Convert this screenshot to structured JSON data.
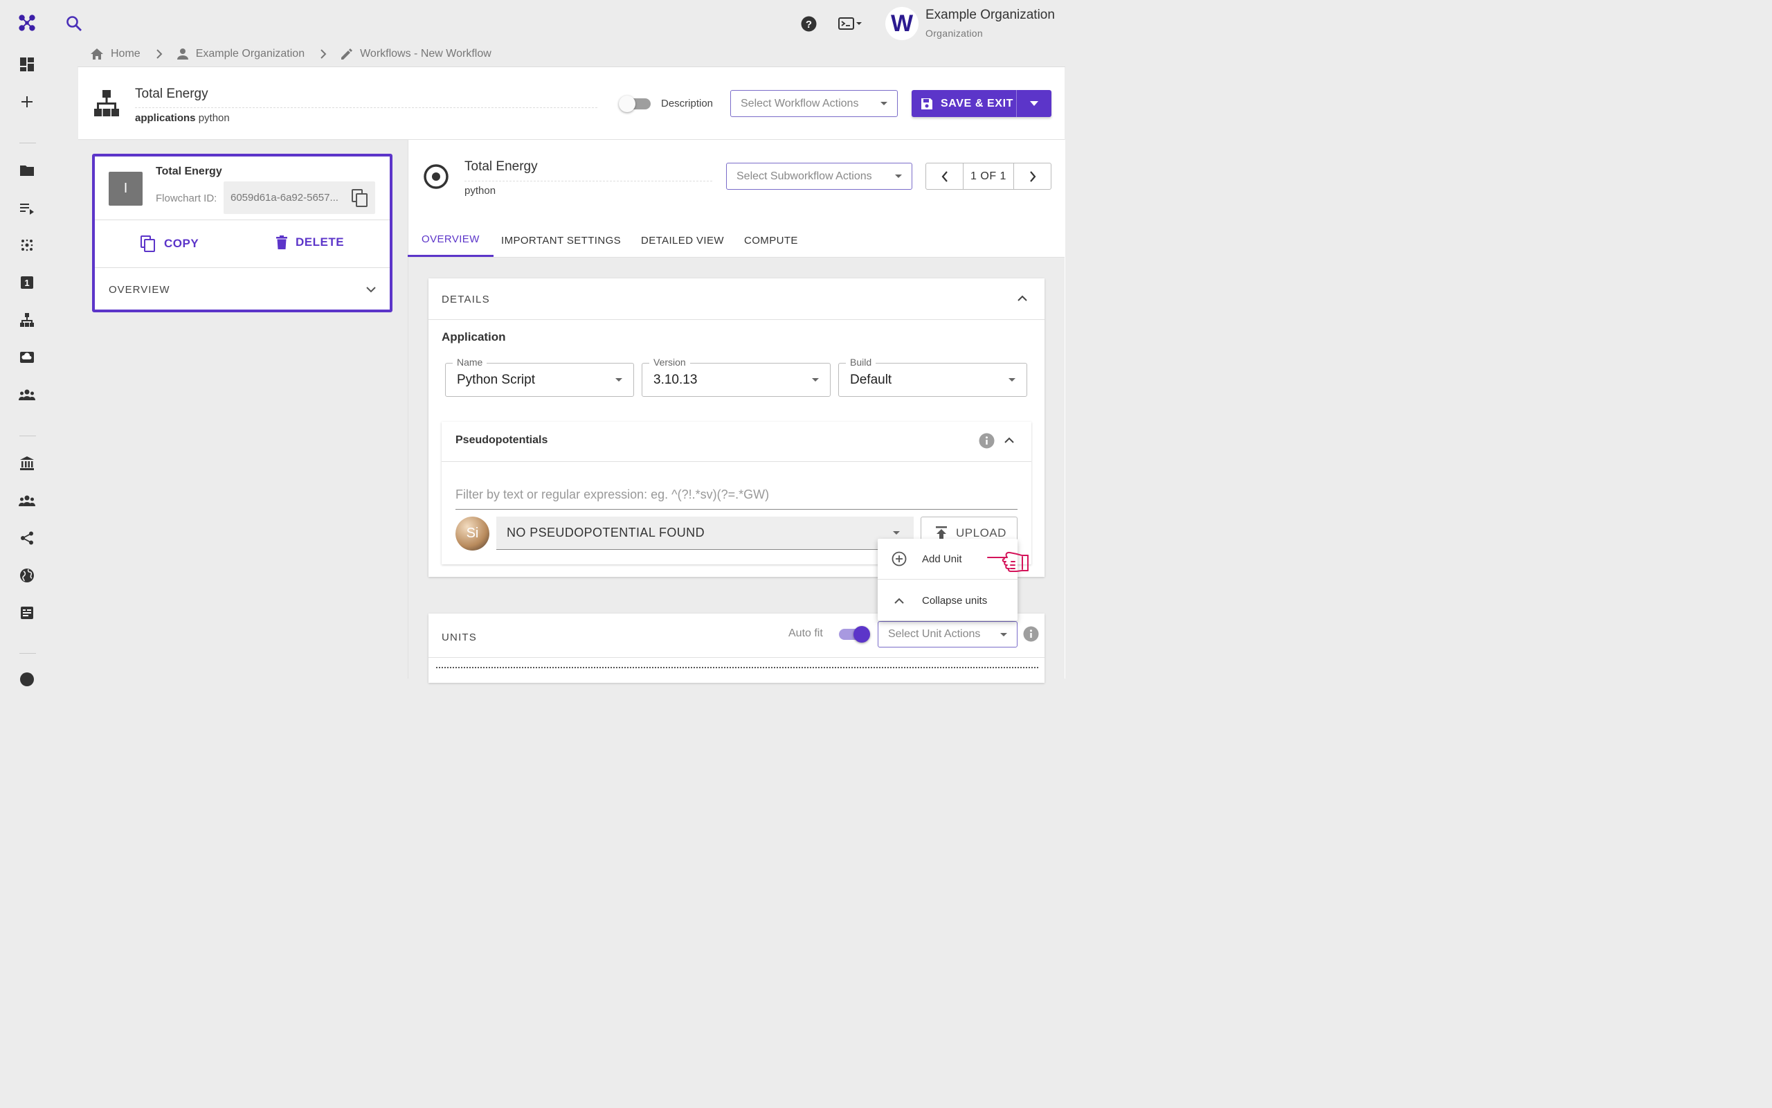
{
  "topbar": {
    "org_initial": "W",
    "org_name": "Example Organization",
    "org_type": "Organization"
  },
  "breadcrumb": {
    "home": "Home",
    "org": "Example Organization",
    "page": "Workflows - New Workflow"
  },
  "workflow": {
    "title": "Total Energy",
    "sub_bold": "applications",
    "sub_value": "python",
    "description_label": "Description",
    "actions_placeholder": "Select Workflow Actions",
    "save_label": "SAVE & EXIT"
  },
  "unit": {
    "avatar_letter": "I",
    "name": "Total Energy",
    "flowchart_label": "Flowchart ID:",
    "flowchart_id": "6059d61a-6a92-5657...",
    "copy_label": "COPY",
    "delete_label": "DELETE",
    "overview_label": "OVERVIEW"
  },
  "subworkflow": {
    "title": "Total Energy",
    "application": "python",
    "actions_placeholder": "Select Subworkflow Actions",
    "pager_text": "1 OF 1"
  },
  "tabs": [
    {
      "label": "OVERVIEW"
    },
    {
      "label": "IMPORTANT SETTINGS"
    },
    {
      "label": "DETAILED VIEW"
    },
    {
      "label": "COMPUTE"
    }
  ],
  "details": {
    "header": "DETAILS",
    "application_label": "Application",
    "name_label": "Name",
    "name_value": "Python Script",
    "version_label": "Version",
    "version_value": "3.10.13",
    "build_label": "Build",
    "build_value": "Default"
  },
  "pseudopotentials": {
    "title": "Pseudopotentials",
    "filter_placeholder": "Filter by text or regular expression: eg. ^(?!.*sv)(?=.*GW)",
    "element": "Si",
    "selected": "NO PSEUDOPOTENTIAL FOUND",
    "upload_label": "UPLOAD"
  },
  "context_menu": {
    "add_unit": "Add Unit",
    "collapse_units": "Collapse units"
  },
  "units": {
    "header": "UNITS",
    "autofit_label": "Auto fit",
    "actions_placeholder": "Select Unit Actions"
  },
  "colors": {
    "accent": "#5c35c9",
    "hand_cursor": "#d4145a"
  }
}
